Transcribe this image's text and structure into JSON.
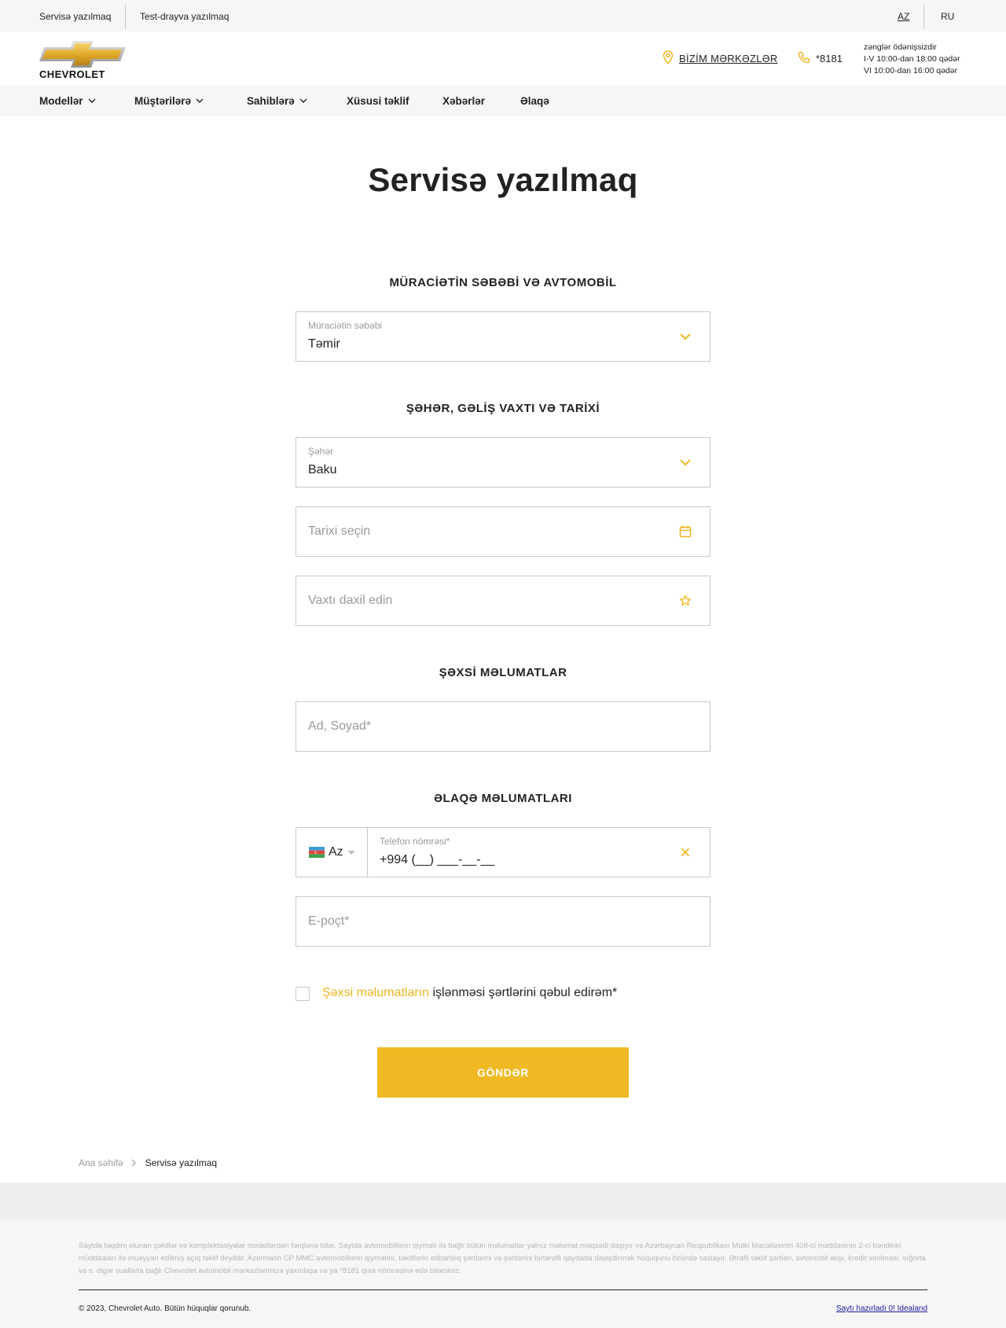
{
  "topbar": {
    "link_service": "Servisə yazılmaq",
    "link_testdrive": "Test-drayva yazılmaq",
    "lang_az": "AZ",
    "lang_ru": "RU"
  },
  "header": {
    "brand": "CHEVROLET",
    "centers": "BİZİM MƏRKƏZLƏR",
    "phone": "*8181",
    "hours_line1": "zənglər ödənişsizdir",
    "hours_line2": "I-V 10:00-dan 18:00 qədər",
    "hours_line3": "VI 10:00-dan 16:00 qədər"
  },
  "nav": {
    "models": "Modellər",
    "customers": "Müştərilərə",
    "owners": "Sahiblərə",
    "offer": "Xüsusi təklif",
    "news": "Xəbərlər",
    "contact": "Əlaqə"
  },
  "page_title": "Servisə yazılmaq",
  "sections": {
    "reason": "MÜRACİƏTİN SƏBƏBİ VƏ AVTOMOBİL",
    "city": "ŞƏHƏR, GƏLİŞ VAXTI VƏ TARİXİ",
    "personal": "ŞƏXSİ MƏLUMATLAR",
    "contact": "ƏLAQƏ MƏLUMATLARI"
  },
  "form": {
    "reason_label": "Müraciətin səbəbi",
    "reason_value": "Təmir",
    "city_label": "Şəhər",
    "city_value": "Baku",
    "date_placeholder": "Tarixi seçin",
    "time_placeholder": "Vaxtı daxil edin",
    "name_placeholder": "Ad, Soyad*",
    "country_code": "Az",
    "phone_label": "Telefon nömrəsi*",
    "phone_value": "+994 (__) ___-__-__",
    "email_placeholder": "E-poçt*",
    "consent_link": "Şəxsi məlumatların",
    "consent_text": " işlənməsi şərtlərini qəbul edirəm*",
    "submit": "GÖNDƏR"
  },
  "icons": {
    "dropdown": "chevron-down-icon",
    "date": "calendar-icon",
    "time": "star-icon",
    "clear": "close-icon",
    "location": "location-pin-icon",
    "phone": "phone-icon"
  },
  "colors": {
    "accent": "#f0b923",
    "text": "#222222",
    "muted": "#9a9a9a"
  },
  "breadcrumb": {
    "home": "Ana səhifə",
    "current": "Servisə yazılmaq"
  },
  "footer": {
    "disclaimer": "Saytda təqdim olunan şəkillər və komplektasiyalar modellərdən fərqlənə bilər. Saytda avtomobillərin qiyməti ilə bağlı bütün məlumatlar yalnız məlumat məqsədi daşıyır və Azərbaycan Respublikası Mülki Məcəlləsinin 408-ci maddəsinin 2-ci bəndinin müddəaları ilə müəyyən edilmiş açıq təklif deyildir. Azermash CP MMC avtomobillərin qiymətini, təkliflərin etibarlılıq şərtlərini və şərtlərini birtərəfli qaydada dəyişdirmək hüququnu özündə saxlayır. Ətraflı təklif şərtləri, avtomobil alışı, kredit verilməsi, sığorta və s. digər suallarla bağlı Chevrolet avtomobil mərkəzlərimizə yaxınlaşa və ya *8181 qısa nömrəsinə edə bilərsiniz.",
    "copyright": "© 2023, Chevrolet Auto. Bütün hüquqlar qorunub.",
    "made_by": "Saytı hazırladı 0! Idealand"
  }
}
